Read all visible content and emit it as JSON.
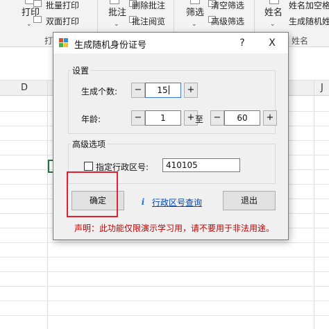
{
  "ribbon": {
    "print_label": "打印",
    "batch_print": "批量打印",
    "duplex_print": "双面打印",
    "print_group_partial": "打",
    "annotate_label": "批注",
    "delete_annotation": "删除批注",
    "review_annotation": "批注阅览",
    "filter_label": "筛选",
    "clear_filter": "清空筛选",
    "advanced_filter": "高级筛选",
    "name_label": "姓名",
    "name_add_partial": "姓名加空格",
    "generate_name_partial": "生成随机姓",
    "name_group": "姓名"
  },
  "sheet": {
    "col_D": "D",
    "col_J": "J"
  },
  "dialog": {
    "title": "生成随机身份证号",
    "help": "?",
    "close": "X",
    "settings_group": "设置",
    "count_label": "生成个数:",
    "count_value": "15",
    "age_label": "年龄:",
    "age_min": "1",
    "age_to": "至",
    "age_max": "60",
    "minus": "−",
    "plus": "+",
    "advanced_group": "高级选项",
    "region_checkbox_label": "指定行政区号:",
    "region_code": "410105",
    "confirm_button": "确定",
    "query_link": "行政区号查询",
    "exit_button": "退出",
    "notice": "声明：此功能仅限演示学习用，请不要用于非法用途。"
  },
  "colors": {
    "accent_green": "#217346",
    "highlight_red": "#e0212b",
    "notice_red": "#c00000",
    "link_blue": "#0645ad"
  }
}
